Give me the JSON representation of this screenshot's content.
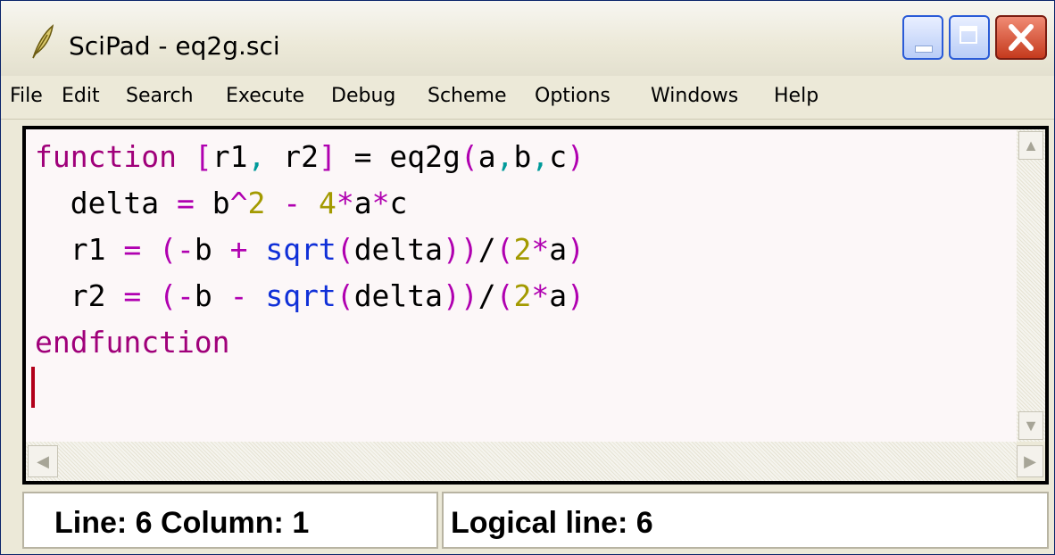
{
  "window": {
    "title": "SciPad - eq2g.sci",
    "controls": {
      "minimize": "minimize",
      "maximize": "maximize",
      "close": "close"
    }
  },
  "menu": {
    "items": [
      "File",
      "Edit",
      "Search",
      "Execute",
      "Debug",
      "Scheme",
      "Options",
      "Windows",
      "Help"
    ]
  },
  "editor": {
    "lines": [
      [
        [
          "function",
          "#a0007a"
        ],
        [
          " ",
          "#000000"
        ],
        [
          "[",
          "#b000b0"
        ],
        [
          "r1",
          "#000000"
        ],
        [
          ",",
          "#009a9a"
        ],
        [
          " r2",
          "#000000"
        ],
        [
          "]",
          "#b000b0"
        ],
        [
          " = ",
          "#000000"
        ],
        [
          "eq2g",
          "#000000"
        ],
        [
          "(",
          "#b000b0"
        ],
        [
          "a",
          "#000000"
        ],
        [
          ",",
          "#009a9a"
        ],
        [
          "b",
          "#000000"
        ],
        [
          ",",
          "#009a9a"
        ],
        [
          "c",
          "#000000"
        ],
        [
          ")",
          "#b000b0"
        ]
      ],
      [
        [
          "  delta ",
          "#000000"
        ],
        [
          "=",
          "#b000b0"
        ],
        [
          " b",
          "#000000"
        ],
        [
          "^",
          "#b000b0"
        ],
        [
          "2",
          "#a39a00"
        ],
        [
          " - ",
          "#b000b0"
        ],
        [
          "4",
          "#a39a00"
        ],
        [
          "*",
          "#b000b0"
        ],
        [
          "a",
          "#000000"
        ],
        [
          "*",
          "#b000b0"
        ],
        [
          "c",
          "#000000"
        ]
      ],
      [
        [
          "  r1 ",
          "#000000"
        ],
        [
          "=",
          "#b000b0"
        ],
        [
          " ",
          "#000000"
        ],
        [
          "(",
          "#b000b0"
        ],
        [
          "-",
          "#b000b0"
        ],
        [
          "b",
          "#000000"
        ],
        [
          " + ",
          "#b000b0"
        ],
        [
          "sqrt",
          "#1030d8"
        ],
        [
          "(",
          "#b000b0"
        ],
        [
          "delta",
          "#000000"
        ],
        [
          "))",
          "#b000b0"
        ],
        [
          "/",
          "#000000"
        ],
        [
          "(",
          "#b000b0"
        ],
        [
          "2",
          "#a39a00"
        ],
        [
          "*",
          "#b000b0"
        ],
        [
          "a",
          "#000000"
        ],
        [
          ")",
          "#b000b0"
        ]
      ],
      [
        [
          "  r2 ",
          "#000000"
        ],
        [
          "=",
          "#b000b0"
        ],
        [
          " ",
          "#000000"
        ],
        [
          "(",
          "#b000b0"
        ],
        [
          "-",
          "#b000b0"
        ],
        [
          "b",
          "#000000"
        ],
        [
          " - ",
          "#b000b0"
        ],
        [
          "sqrt",
          "#1030d8"
        ],
        [
          "(",
          "#b000b0"
        ],
        [
          "delta",
          "#000000"
        ],
        [
          "))",
          "#b000b0"
        ],
        [
          "/",
          "#000000"
        ],
        [
          "(",
          "#b000b0"
        ],
        [
          "2",
          "#a39a00"
        ],
        [
          "*",
          "#b000b0"
        ],
        [
          "a",
          "#000000"
        ],
        [
          ")",
          "#b000b0"
        ]
      ],
      [
        [
          "endfunction",
          "#a0007a"
        ]
      ]
    ]
  },
  "status": {
    "position": "Line: 6 Column: 1",
    "logical_line": "Logical line: 6"
  },
  "colors": {
    "keyword": "#a0007a",
    "operator": "#b000b0",
    "number": "#a39a00",
    "builtin": "#1030d8",
    "separator": "#009a9a",
    "cursor": "#b2001a",
    "background": "#fcf7f8"
  },
  "icons": {
    "app": "feather-icon",
    "minimize": "minimize-icon",
    "maximize": "maximize-icon",
    "close": "close-icon",
    "scroll_up": "arrow-up-icon",
    "scroll_down": "arrow-down-icon",
    "scroll_left": "arrow-left-icon",
    "scroll_right": "arrow-right-icon"
  }
}
